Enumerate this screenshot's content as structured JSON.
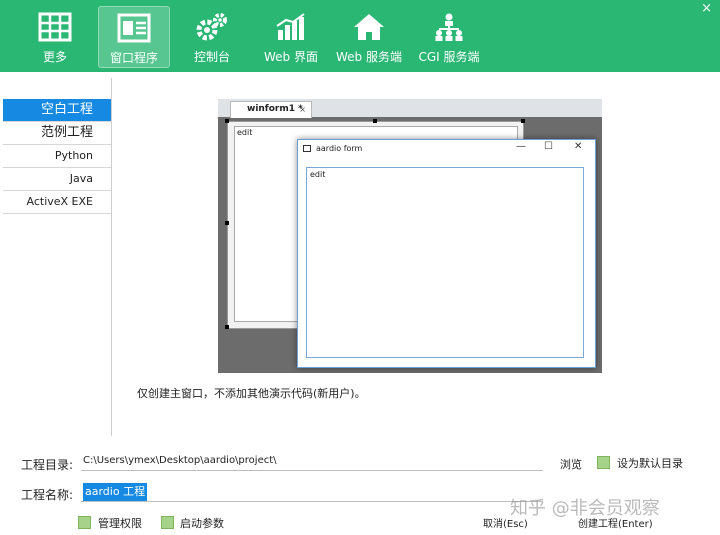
{
  "toolbar": {
    "close": "×",
    "items": [
      {
        "label": "更多",
        "icon": "grid-icon"
      },
      {
        "label": "窗口程序",
        "icon": "window-form-icon",
        "active": true
      },
      {
        "label": "控制台",
        "icon": "gears-icon"
      },
      {
        "label": "Web 界面",
        "icon": "bar-chart-icon"
      },
      {
        "label": "Web 服务端",
        "icon": "house-icon"
      },
      {
        "label": "CGI 服务端",
        "icon": "people-network-icon"
      }
    ]
  },
  "sidebar": {
    "items": [
      {
        "label": "空白工程",
        "active": true
      },
      {
        "label": "范例工程"
      },
      {
        "label": "Python"
      },
      {
        "label": "Java"
      },
      {
        "label": "ActiveX EXE"
      }
    ]
  },
  "preview": {
    "tab_label": "winform1 *",
    "tab_close": "×",
    "design_edit_text": "edit",
    "window_title": "aardio form",
    "window_controls": [
      "—",
      "☐",
      "✕"
    ],
    "window_edit_text": "edit"
  },
  "description": "仅创建主窗口，不添加其他演示代码(新用户)。",
  "form": {
    "dir_label": "工程目录:",
    "dir_value": "C:\\Users\\ymex\\Desktop\\aardio\\project\\",
    "browse_label": "浏览",
    "default_dir_label": "设为默认目录",
    "name_label": "工程名称:",
    "name_value": "aardio 工程",
    "admin_label": "管理权限",
    "params_label": "启动参数",
    "cancel_label": "取消(Esc)",
    "create_label": "创建工程(Enter)"
  },
  "watermark": "知乎 @非会员观察",
  "colors": {
    "toolbar_bg": "#2ab673",
    "active_item": "#1689e3",
    "checkbox": "#a7d28a"
  }
}
